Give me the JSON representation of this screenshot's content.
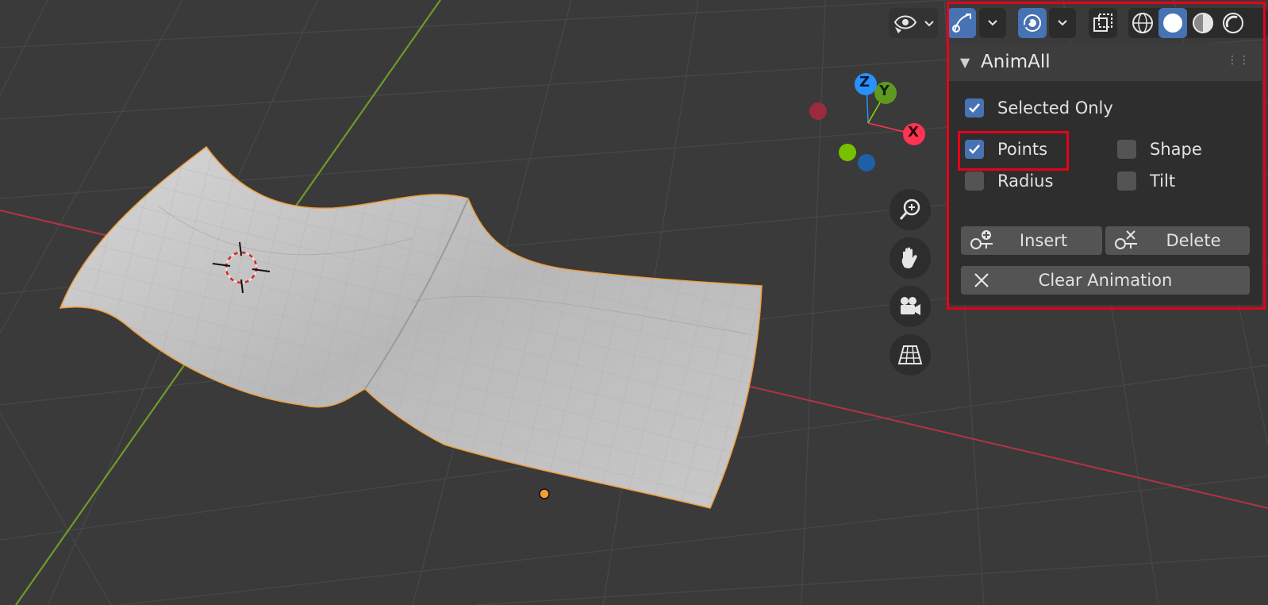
{
  "panel": {
    "title": "AnimAll",
    "checkboxes": [
      {
        "label": "Selected Only",
        "checked": true
      },
      {
        "label": "Points",
        "checked": true
      },
      {
        "label": "Shape",
        "checked": false
      },
      {
        "label": "Radius",
        "checked": false
      },
      {
        "label": "Tilt",
        "checked": false
      }
    ],
    "buttons": {
      "insert": "Insert",
      "delete": "Delete",
      "clear": "Clear Animation"
    }
  },
  "gizmo": {
    "x_label": "X",
    "y_label": "Y",
    "z_label": "Z"
  },
  "colors": {
    "accent": "#4772b3",
    "highlight": "#e8001a",
    "axis_x": "#ff3352",
    "axis_y": "#8bdc00",
    "axis_z": "#2890ff",
    "selection_outline": "#f29d35"
  },
  "icons": {
    "toolbar": [
      "eye-icon",
      "gizmo-toggle-icon",
      "overlay-toggle-icon",
      "xray-icon",
      "wireframe-shading-icon",
      "solid-shading-icon",
      "material-shading-icon",
      "rendered-shading-icon"
    ],
    "navigation": [
      "zoom-icon",
      "pan-hand-icon",
      "camera-icon",
      "grid-ortho-icon"
    ]
  }
}
